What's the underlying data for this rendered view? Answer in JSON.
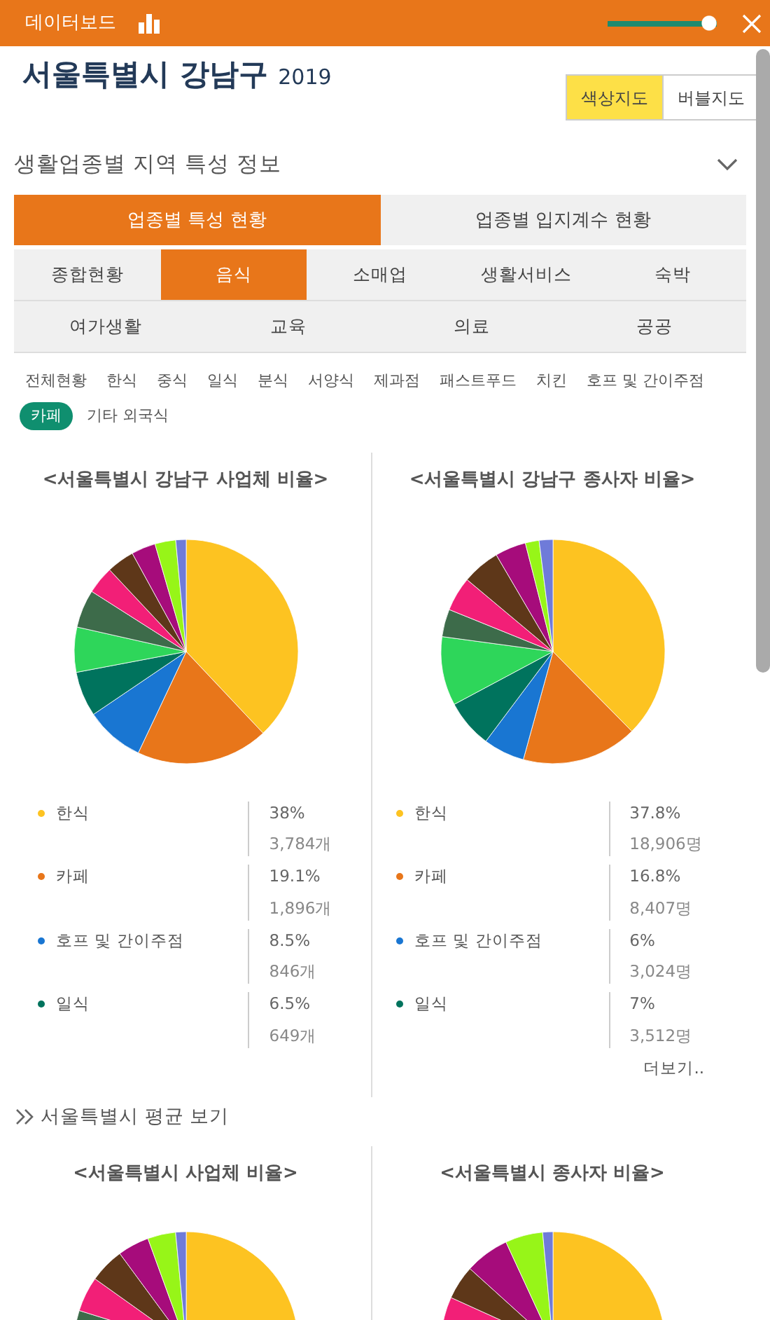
{
  "header": {
    "title": "데이터보드",
    "slider": {
      "level": 0.97
    }
  },
  "region": {
    "name": "서울특별시 강남구",
    "year": "2019"
  },
  "map_toggle": [
    {
      "label": "색상지도",
      "selected": true
    },
    {
      "label": "버블지도",
      "selected": false
    }
  ],
  "section": {
    "title": "생활업종별 지역 특성 정보"
  },
  "main_tabs": [
    {
      "label": "업종별 특성 현황",
      "selected": true
    },
    {
      "label": "업종별 입지계수 현황",
      "selected": false
    }
  ],
  "category_rows": [
    [
      {
        "label": "종합현황",
        "selected": false
      },
      {
        "label": "음식",
        "selected": true
      },
      {
        "label": "소매업",
        "selected": false
      },
      {
        "label": "생활서비스",
        "selected": false
      },
      {
        "label": "숙박",
        "selected": false
      }
    ],
    [
      {
        "label": "여가생활",
        "selected": false
      },
      {
        "label": "교육",
        "selected": false
      },
      {
        "label": "의료",
        "selected": false
      },
      {
        "label": "공공",
        "selected": false
      }
    ]
  ],
  "subcategories": [
    {
      "label": "전체현황",
      "selected": false
    },
    {
      "label": "한식",
      "selected": false
    },
    {
      "label": "중식",
      "selected": false
    },
    {
      "label": "일식",
      "selected": false
    },
    {
      "label": "분식",
      "selected": false
    },
    {
      "label": "서양식",
      "selected": false
    },
    {
      "label": "제과점",
      "selected": false
    },
    {
      "label": "패스트푸드",
      "selected": false
    },
    {
      "label": "치킨",
      "selected": false
    },
    {
      "label": "호프 및 간이주점",
      "selected": false
    },
    {
      "label": "카페",
      "selected": true
    },
    {
      "label": "기타 외국식",
      "selected": false
    }
  ],
  "charts": [
    {
      "title": "<서울특별시 강남구 사업체 비율>",
      "legend": [
        {
          "label": "한식",
          "color": "#fdc321",
          "percent": "38%",
          "count": "3,784개"
        },
        {
          "label": "카페",
          "color": "#e8761a",
          "percent": "19.1%",
          "count": "1,896개"
        },
        {
          "label": "호프 및 간이주점",
          "color": "#1976d2",
          "percent": "8.5%",
          "count": "846개"
        },
        {
          "label": "일식",
          "color": "#00735d",
          "percent": "6.5%",
          "count": "649개"
        }
      ]
    },
    {
      "title": "<서울특별시 강남구 종사자 비율>",
      "legend": [
        {
          "label": "한식",
          "color": "#fdc321",
          "percent": "37.8%",
          "count": "18,906명"
        },
        {
          "label": "카페",
          "color": "#e8761a",
          "percent": "16.8%",
          "count": "8,407명"
        },
        {
          "label": "호프 및 간이주점",
          "color": "#1976d2",
          "percent": "6%",
          "count": "3,024명"
        },
        {
          "label": "일식",
          "color": "#00735d",
          "percent": "7%",
          "count": "3,512명"
        }
      ],
      "more": "더보기.."
    }
  ],
  "average_link": "서울특별시 평균 보기",
  "average_charts": [
    {
      "title": "<서울특별시 사업체 비율>"
    },
    {
      "title": "<서울특별시 종사자 비율>"
    }
  ]
}
